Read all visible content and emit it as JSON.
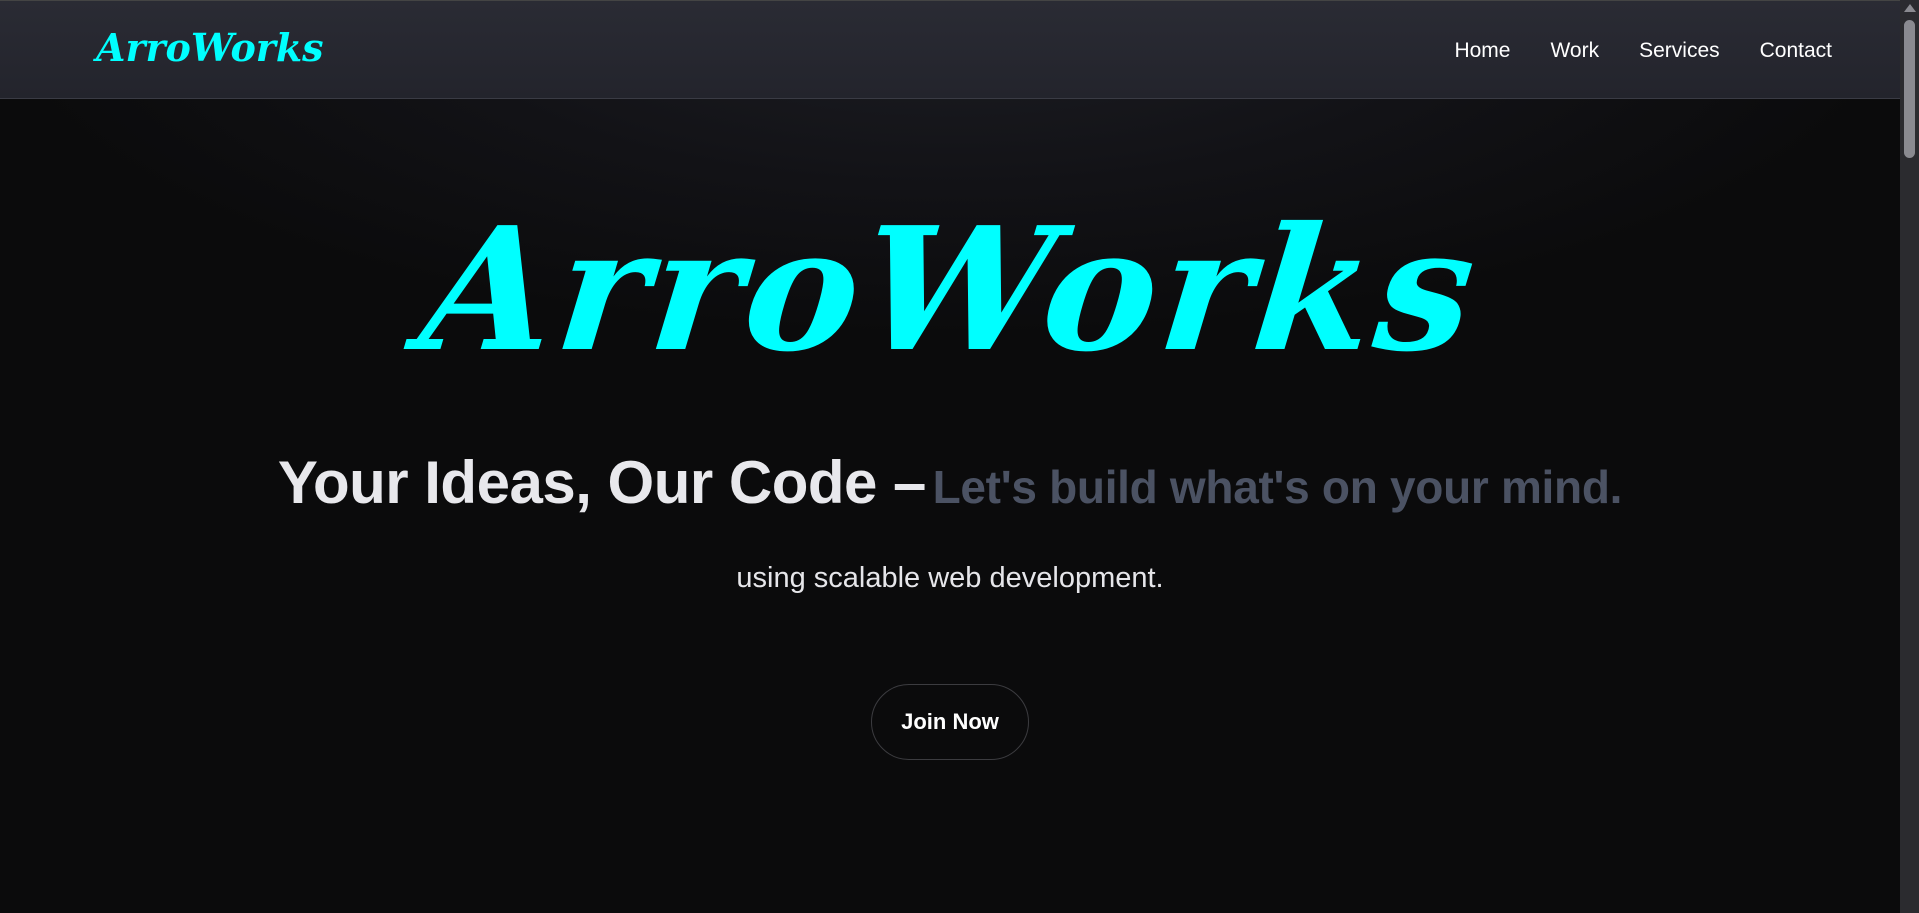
{
  "nav": {
    "logo": "ArroWorks",
    "links": [
      "Home",
      "Work",
      "Services",
      "Contact"
    ]
  },
  "hero": {
    "logo": "ArroWorks",
    "headline_main": "Your Ideas, Our Code –",
    "headline_sub": "Let's build what's on your mind.",
    "tagline": "using scalable web development.",
    "cta_label": "Join Now"
  },
  "colors": {
    "brand": "#00ffff",
    "background": "#0b0b0c",
    "navbar": "#26272f",
    "muted_text": "#4b5263"
  }
}
